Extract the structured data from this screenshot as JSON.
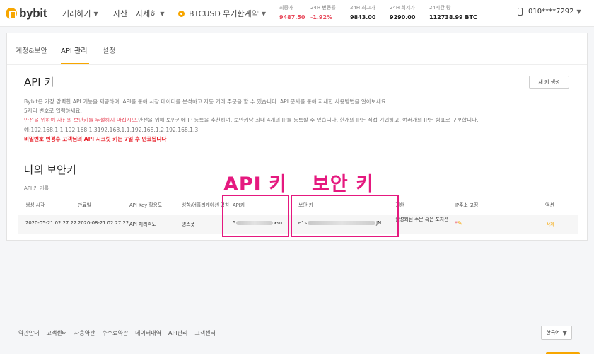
{
  "header": {
    "logo_text": "bybit",
    "nav": {
      "trade": "거래하기",
      "assets": "자산",
      "more": "자세히",
      "contract": "BTCUSD 무기한계약"
    },
    "stats": [
      {
        "label": "최종가",
        "value": "9487.50",
        "color": "red"
      },
      {
        "label": "24H 변동률",
        "value": "-1.92%",
        "color": "red"
      },
      {
        "label": "24H 최고가",
        "value": "9843.00",
        "color": "normal"
      },
      {
        "label": "24H 최저가",
        "value": "9290.00",
        "color": "normal"
      },
      {
        "label": "24시간 량",
        "value": "112738.99 BTC",
        "color": "normal"
      }
    ],
    "user_phone": "010****7292"
  },
  "tabs": [
    "계정&보안",
    "API 관리",
    "설정"
  ],
  "active_tab": "API 관리",
  "api_section": {
    "title": "API 키",
    "new_key_button": "새 키 생성",
    "desc_line1": "Bybit은 가장 강력한 API 기능을 제공하며, API를 통해 시장 데이터를 분석하고 자동 거래 주문을 할 수 있습니다. API 문서를 통해 자세한 사용방법을 알아보세요.",
    "desc_line2": "5자리 번호로 입력하세요.",
    "desc_line3_red": "안전을 위하여 자신의 보안키를 누설하지 마십시오.",
    "desc_line3_rest": "안전을 위해 보안키에 IP 등록을 추천하며, 보안키당 최대 4개의 IP를 등록할 수 있습니다. 한개의 IP는 직접 기입하고, 여러개의 IP는 쉼표로 구분합니다.",
    "desc_line4": "예:192.168.1.1,192.168.1.3192.168.1.1,192.168.1.2,192.168.1.3",
    "warning": "비밀번호 변경후 고객님의 API 시크릿 키는 7일 후 만료됩니다"
  },
  "keys_section": {
    "title": "나의 보안키",
    "sub_label": "API 키 기록",
    "columns": [
      "생성 시각",
      "만료일",
      "API Key 활용도",
      "성함/어플리케이션 명칭",
      "API키",
      "보안 키",
      "권한",
      "IP주소 고정",
      "액션"
    ],
    "row": {
      "created": "2020-05-21 02:27:22",
      "expires": "2020-08-21 02:27:22",
      "usage": "API 처리속도",
      "name": "명스폿",
      "api_key_start": "5",
      "api_key_end": "xsu",
      "secret_start": "e1s",
      "secret_end": "JN...",
      "permission": "활성화된 주문 혹은 포지션",
      "ip_marker": "*",
      "action": "삭제"
    }
  },
  "annotations": {
    "api_key": "API 키",
    "secret_key": "보안 키"
  },
  "footer": {
    "links": [
      "약관안내",
      "고객센터",
      "사용약관",
      "수수료약관",
      "데이터내역",
      "API관리",
      "고객센터"
    ],
    "language": "한국어"
  },
  "colors": {
    "brand": "#f7a600",
    "price_red": "#e8495b",
    "annotation": "#e5197f"
  }
}
